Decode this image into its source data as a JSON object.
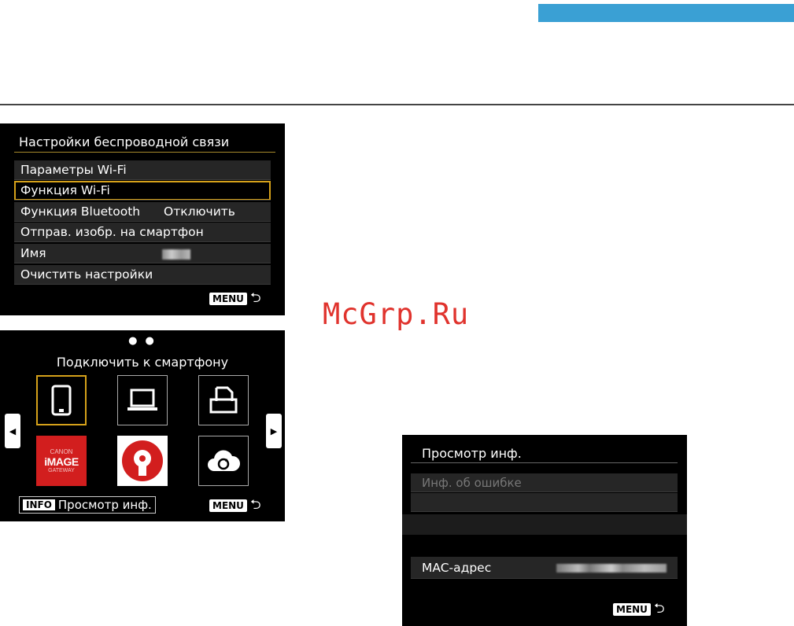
{
  "page": {
    "accent_color": "#3aa0d4",
    "watermark": "McGrp.Ru"
  },
  "screen_wireless": {
    "title": "Настройки беспроводной связи",
    "items": [
      {
        "label": "Параметры Wi-Fi",
        "value": ""
      },
      {
        "label": "Функция Wi-Fi",
        "value": "",
        "selected": true
      },
      {
        "label": "Функция Bluetooth",
        "value": "Отключить"
      },
      {
        "label": "Отправ. изобр. на смартфон",
        "value": ""
      },
      {
        "label": "Имя",
        "value": ""
      },
      {
        "label": "Очистить настройки",
        "value": ""
      }
    ],
    "menu_key": "MENU",
    "selection_color": "#d5a11a"
  },
  "screen_connect": {
    "page_dots": "● ●",
    "title": "Подключить к смартфону",
    "tiles": [
      {
        "icon": "smartphone-icon",
        "selected": true
      },
      {
        "icon": "laptop-icon"
      },
      {
        "icon": "printer-icon"
      },
      {
        "icon": "canon-image-gateway-icon",
        "text_top": "CANON",
        "text_main": "iMAGE",
        "text_bottom": "GATEWAY"
      },
      {
        "icon": "connect-app-icon"
      },
      {
        "icon": "cloud-sync-icon"
      }
    ],
    "info_key": "INFO",
    "info_label": "Просмотр инф.",
    "menu_key": "MENU"
  },
  "screen_info": {
    "title": "Просмотр инф.",
    "error_item": "Инф. об ошибке",
    "mac_label": "MAC-адрес",
    "menu_key": "MENU"
  }
}
